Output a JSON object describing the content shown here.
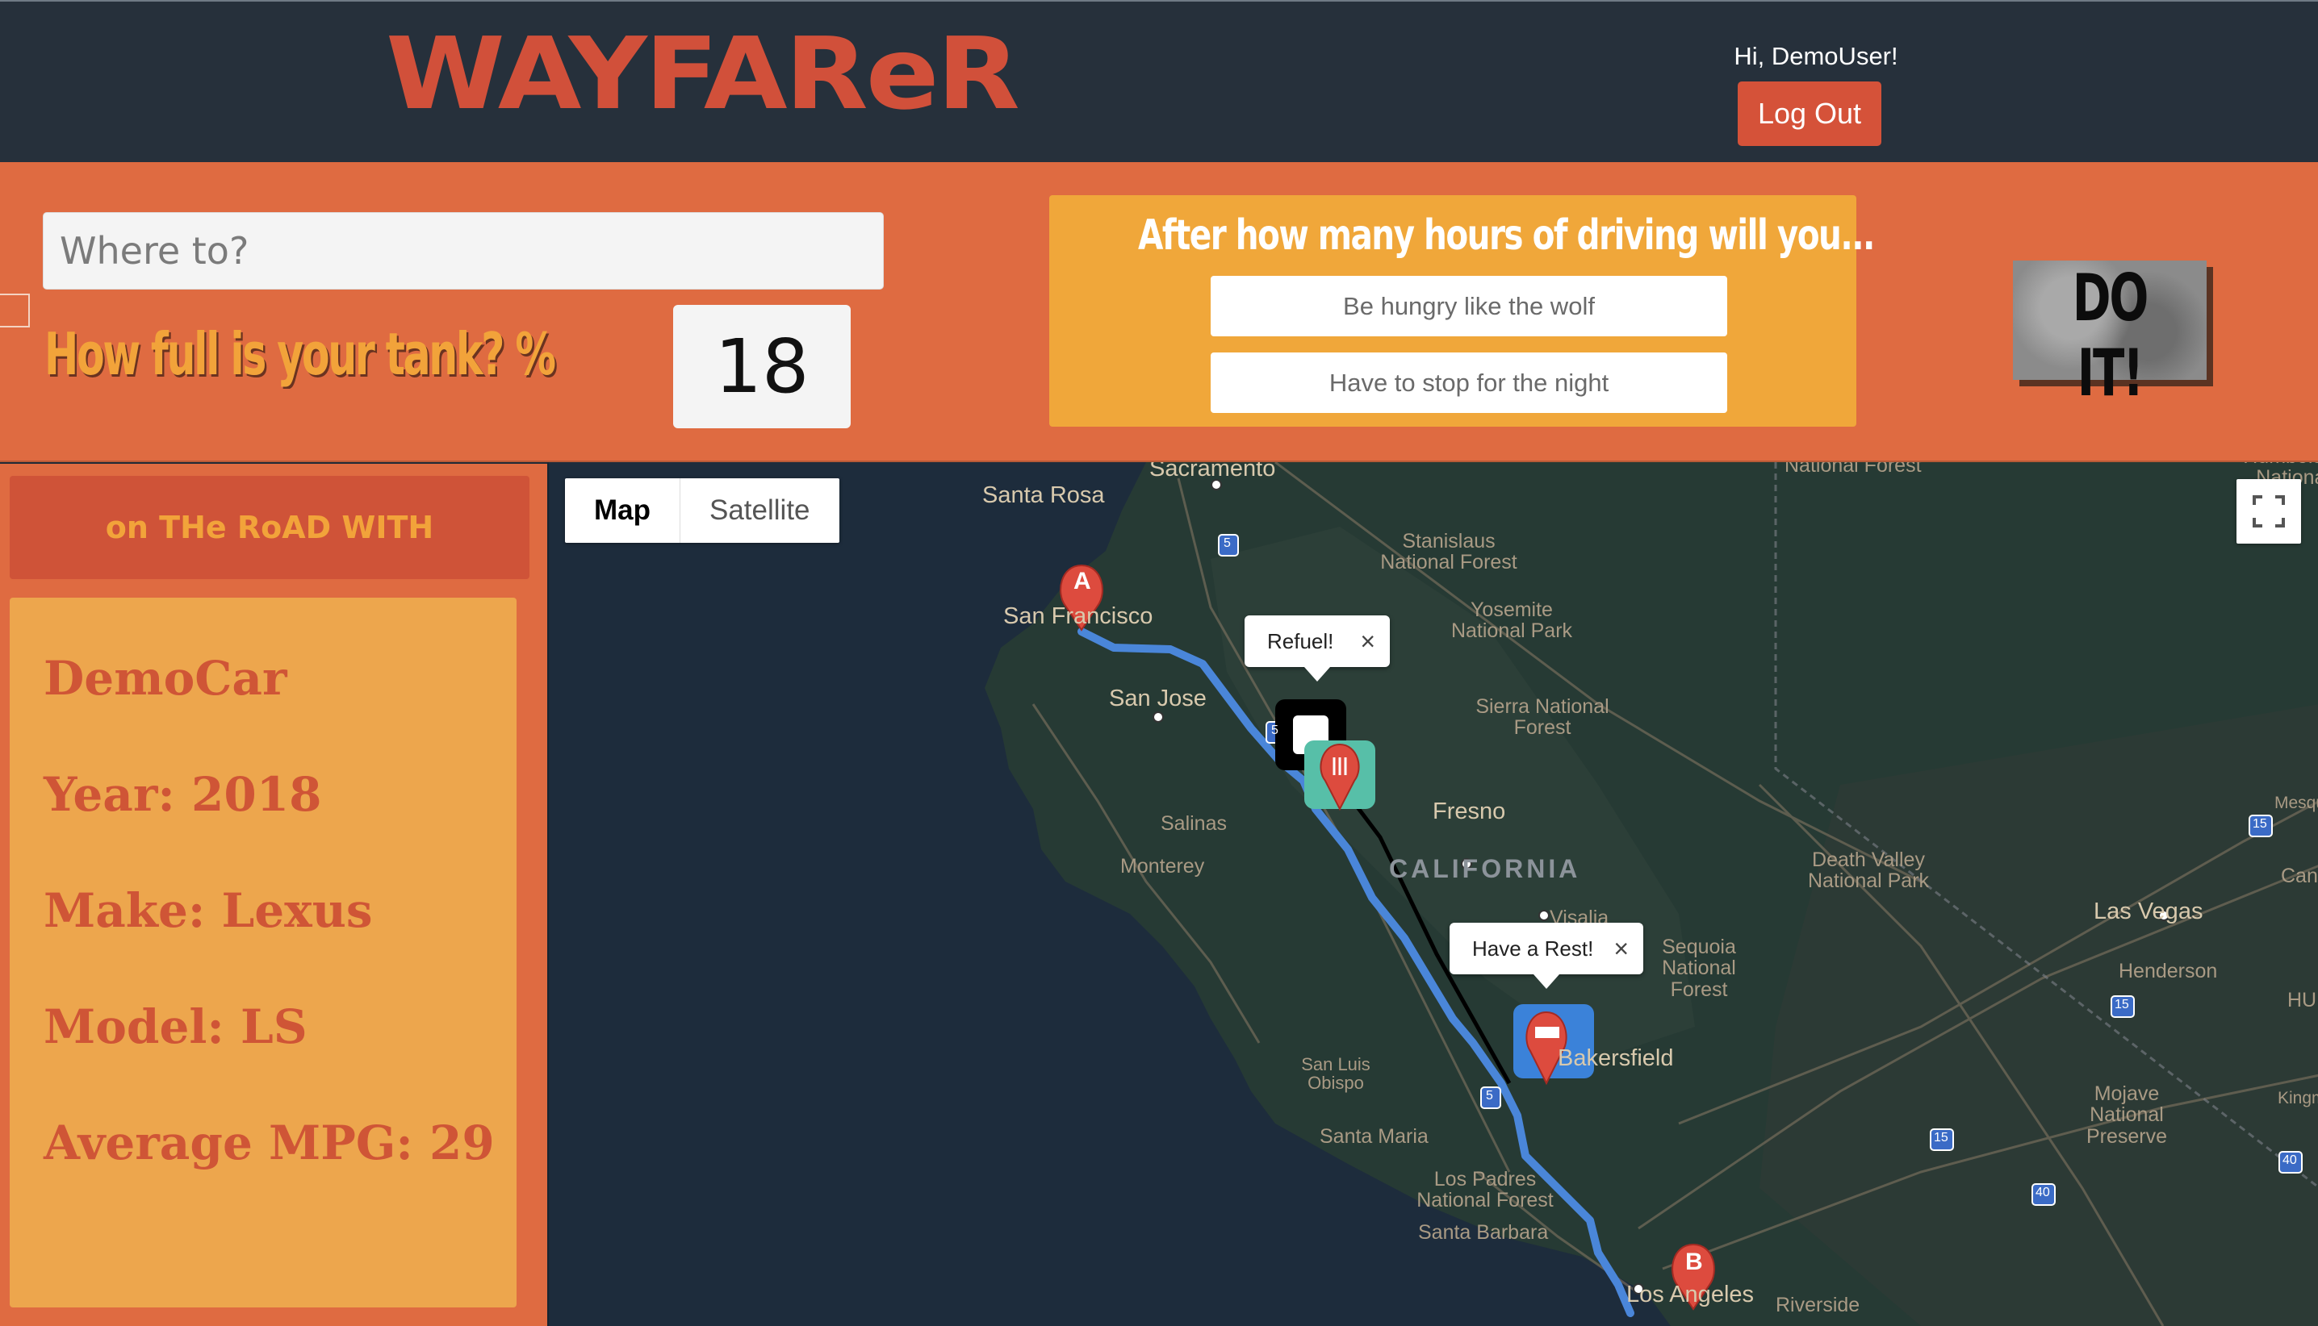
{
  "header": {
    "logo": "WAYFAReR",
    "greeting": "Hi, DemoUser!",
    "logout_label": "Log Out"
  },
  "form": {
    "destination_placeholder": "Where to?",
    "tank_label": "How full is your tank? %",
    "tank_value": "18",
    "hours_title": "After how many hours of driving will you...",
    "hungry_placeholder": "Be hungry like the wolf",
    "night_placeholder": "Have to stop for the night",
    "submit_label": "DO IT!"
  },
  "sidebar": {
    "banner": "on THe RoAD WITH",
    "car_name": "DemoCar",
    "year": "Year: 2018",
    "make": "Make: Lexus",
    "model": "Model: LS",
    "mpg": "Average MPG: 29"
  },
  "map": {
    "type_map": "Map",
    "type_satellite": "Satellite",
    "info_refuel": "Refuel!",
    "info_rest": "Have a Rest!",
    "close_glyph": "×",
    "marker_a": "A",
    "marker_b": "B",
    "labels": {
      "sacramento": "Sacramento",
      "santa_rosa": "Santa Rosa",
      "san_francisco": "San Francisco",
      "san_jose": "San Jose",
      "salinas": "Salinas",
      "monterey": "Monterey",
      "fresno": "Fresno",
      "california": "CALIFORNIA",
      "visalia": "Visalia",
      "sequoia": "Sequoia National Forest",
      "bakersfield": "Bakersfield",
      "san_luis_obispo": "San Luis Obispo",
      "santa_maria": "Santa Maria",
      "los_padres": "Los Padres National Forest",
      "santa_barbara": "Santa Barbara",
      "los_angeles": "Los Angeles",
      "riverside": "Riverside",
      "stanislaus": "Stanislaus National Forest",
      "yosemite": "Yosemite National Park",
      "sierra": "Sierra National Forest",
      "humboldt": "Humboldt-Toiyabe National Forest",
      "death_valley": "Death Valley National Park",
      "las_vegas": "Las Vegas",
      "henderson": "Henderson",
      "mojave": "Mojave National Preserve",
      "mesquite": "Mesqu",
      "canyon": "Cany",
      "kingman": "Kingm",
      "hu": "HU",
      "national_forest": "National Forest"
    },
    "shields": [
      "5",
      "5",
      "5",
      "15",
      "15",
      "15",
      "40",
      "40",
      "40",
      "15"
    ]
  },
  "colors": {
    "header_bg": "#26303b",
    "accent_orange": "#df6b41",
    "accent_red": "#d1503a",
    "accent_yellow": "#f0a73a",
    "route_blue": "#4a86d9",
    "map_bg": "#1d2c3c"
  }
}
